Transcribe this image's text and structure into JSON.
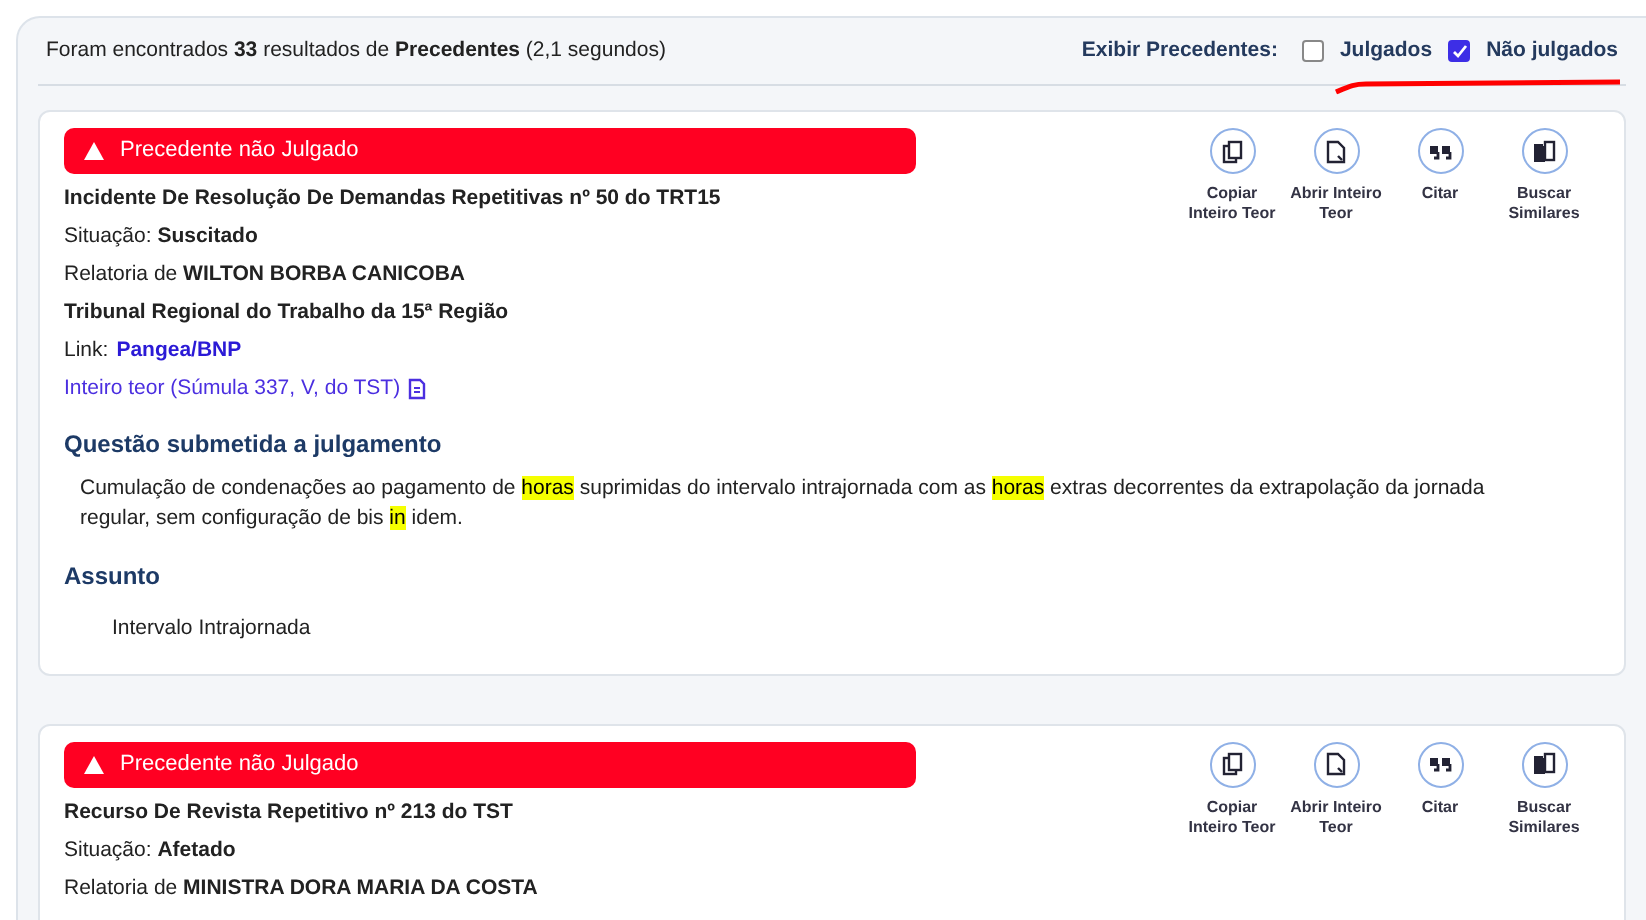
{
  "header": {
    "summary": "Foram encontrados **33** resultados de **Precedentes** (2,1 segundos)",
    "filter_label": "Exibir Precedentes:",
    "filters": [
      {
        "label": "Julgados",
        "checked": false
      },
      {
        "label": "Não julgados",
        "checked": true
      }
    ]
  },
  "results": [
    {
      "status_banner": "Precedente não Julgado",
      "title": "Incidente De Resolução De Demandas Repetitivas nº 50 do TRT15",
      "situacao": "Situação: **Suscitado**",
      "relatoria": "Relatoria de **WILTON BORBA CANICOBA**",
      "tribunal": "Tribunal Regional do Trabalho da 15ª Região",
      "link_label": "Link:",
      "link": "Pangea/BNP",
      "document_link": "Inteiro teor (Súmula 337, V, do TST)",
      "sections": [
        {
          "heading": "Questão submetida a julgamento",
          "kind": "highlighted",
          "segments": [
            {
              "text": "Cumulação de condenações ao pagamento de ",
              "highlight": false
            },
            {
              "text": "horas",
              "highlight": true
            },
            {
              "text": " suprimidas do intervalo intrajornada com as ",
              "highlight": false
            },
            {
              "text": "horas",
              "highlight": true
            },
            {
              "text": " extras decorrentes da extrapolação da jornada regular, sem configuração de bis ",
              "highlight": false
            },
            {
              "text": "in",
              "highlight": true
            },
            {
              "text": " idem.",
              "highlight": false
            }
          ]
        },
        {
          "heading": "Assunto",
          "kind": "list",
          "text": "Intervalo Intrajornada"
        }
      ],
      "actions": [
        {
          "kind": "copy",
          "label": "Copiar Inteiro Teor"
        },
        {
          "kind": "open",
          "label": "Abrir Inteiro Teor"
        },
        {
          "kind": "quote",
          "label": "Citar"
        },
        {
          "kind": "similar",
          "label": "Buscar Similares"
        }
      ]
    },
    {
      "status_banner": "Precedente não Julgado",
      "title": "Recurso De Revista Repetitivo nº 213 do TST",
      "situacao": "Situação: **Afetado**",
      "relatoria": "Relatoria de **MINISTRA DORA MARIA DA COSTA**",
      "actions": [
        {
          "kind": "copy",
          "label": "Copiar Inteiro Teor"
        },
        {
          "kind": "open",
          "label": "Abrir Inteiro Teor"
        },
        {
          "kind": "quote",
          "label": "Citar"
        },
        {
          "kind": "similar",
          "label": "Buscar Similares"
        }
      ]
    }
  ]
}
